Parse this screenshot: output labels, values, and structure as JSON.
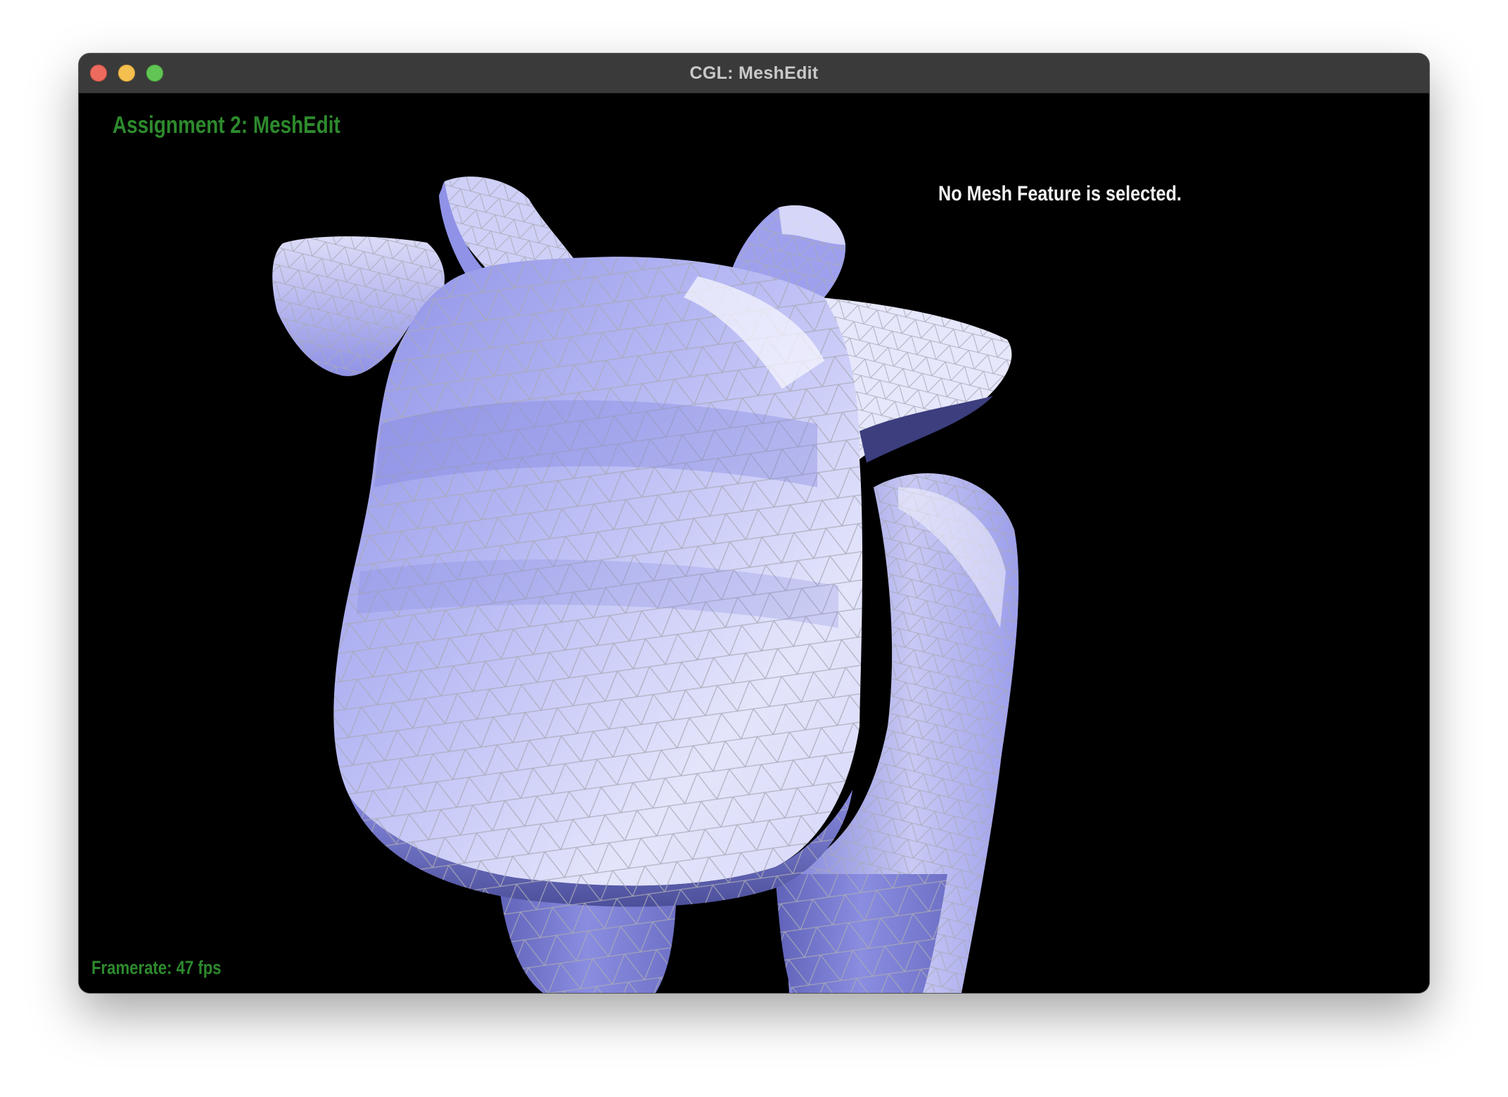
{
  "window": {
    "title": "CGL: MeshEdit",
    "background_color": "#000000",
    "titlebar_color": "#3a3a3a",
    "controls": [
      "close-button",
      "minimize-button",
      "zoom-button"
    ]
  },
  "viewport": {
    "assignment_title": "Assignment 2: MeshEdit",
    "selection_status": "No Mesh Feature is selected.",
    "framerate": "Framerate: 47 fps",
    "mesh": {
      "shading": "flat with wireframe overlay",
      "surface_color": "#9a9cf0",
      "wire_color": "#aaaaaa",
      "hud_accent_color": "#2d8a2d"
    }
  }
}
